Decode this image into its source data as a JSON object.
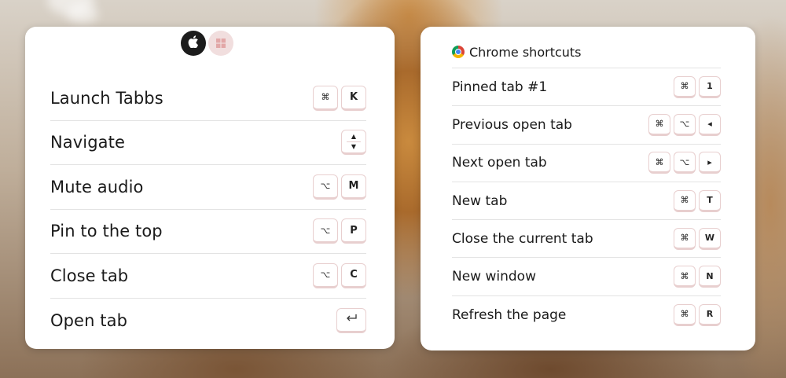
{
  "os_toggle": {
    "options": [
      {
        "name": "mac",
        "icon": "apple-icon",
        "active": true
      },
      {
        "name": "windows",
        "icon": "windows-icon",
        "active": false
      }
    ]
  },
  "app_shortcuts": [
    {
      "label": "Launch Tabbs",
      "keys": [
        "⌘",
        "K"
      ]
    },
    {
      "label": "Navigate",
      "keys": [
        "▲▼"
      ]
    },
    {
      "label": "Mute audio",
      "keys": [
        "⌥",
        "M"
      ]
    },
    {
      "label": "Pin to the top",
      "keys": [
        "⌥",
        "P"
      ]
    },
    {
      "label": "Close tab",
      "keys": [
        "⌥",
        "C"
      ]
    },
    {
      "label": "Open tab",
      "keys": [
        "⏎"
      ]
    }
  ],
  "chrome": {
    "title": "Chrome shortcuts",
    "icon": "chrome-icon",
    "shortcuts": [
      {
        "label": "Pinned tab #1",
        "keys": [
          "⌘",
          "1"
        ]
      },
      {
        "label": "Previous open tab",
        "keys": [
          "⌘",
          "⌥",
          "◂"
        ]
      },
      {
        "label": "Next open tab",
        "keys": [
          "⌘",
          "⌥",
          "▸"
        ]
      },
      {
        "label": "New tab",
        "keys": [
          "⌘",
          "T"
        ]
      },
      {
        "label": "Close the current tab",
        "keys": [
          "⌘",
          "W"
        ]
      },
      {
        "label": "New window",
        "keys": [
          "⌘",
          "N"
        ]
      },
      {
        "label": "Refresh the page",
        "keys": [
          "⌘",
          "R"
        ]
      }
    ]
  },
  "colors": {
    "panel_bg": "#ffffff",
    "key_border": "#e8cfcf",
    "active_toggle": "#1c1c1c",
    "inactive_toggle": "#f1dede"
  }
}
